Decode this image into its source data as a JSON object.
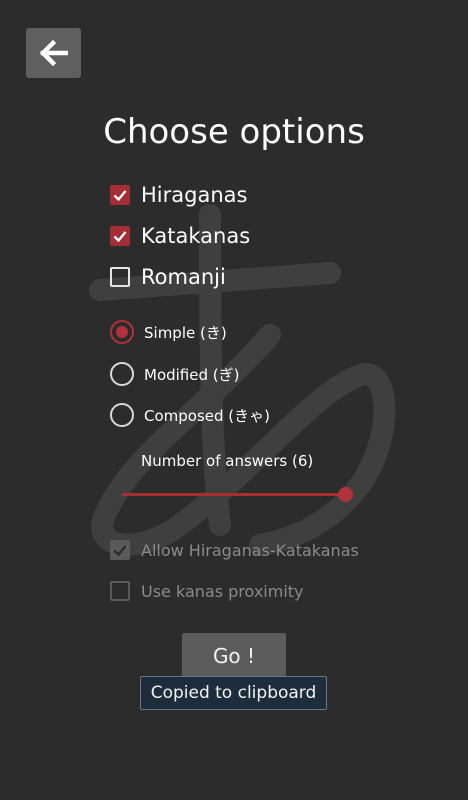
{
  "colors": {
    "background": "#2c2c2c",
    "accent": "#a52d36",
    "button": "#5c5c5c",
    "toast_background": "#1d2d3b",
    "disabled": "#8a8a8a"
  },
  "header": {
    "back_icon": "arrow-left-icon",
    "title": "Choose options"
  },
  "kana_types": [
    {
      "label": "Hiraganas",
      "checked": true
    },
    {
      "label": "Katakanas",
      "checked": true
    },
    {
      "label": "Romanji",
      "checked": false
    }
  ],
  "modes": [
    {
      "label": "Simple (き)",
      "selected": true
    },
    {
      "label": "Modified (ぎ)",
      "selected": false
    },
    {
      "label": "Composed (きゃ)",
      "selected": false
    }
  ],
  "answers": {
    "label": "Number of answers (6)",
    "value": 6,
    "fraction": 1.0
  },
  "extra_options": [
    {
      "label": "Allow Hiraganas-Katakanas",
      "checked": true,
      "enabled": false
    },
    {
      "label": "Use kanas proximity",
      "checked": false,
      "enabled": false
    }
  ],
  "go_button": {
    "label": "Go !"
  },
  "toast": {
    "text": "Copied to clipboard"
  },
  "watermark_icon": "hiragana-a-icon"
}
